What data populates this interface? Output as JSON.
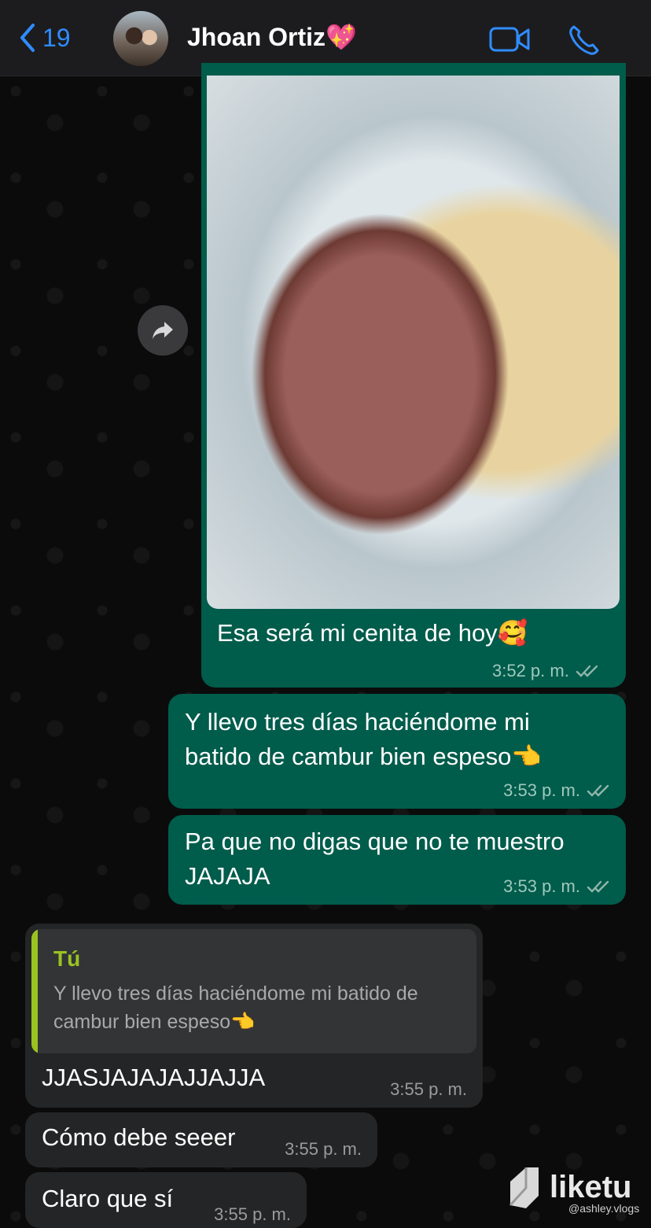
{
  "header": {
    "back_count": "19",
    "contact_name": "Jhoan Ortiz💖"
  },
  "messages": [
    {
      "type": "out",
      "text": "Esa será mi cenita de hoy🥰",
      "time": "3:52 p. m."
    },
    {
      "type": "out",
      "text": "Y llevo tres días haciéndome mi batido de cambur bien espeso👈",
      "time": "3:53 p. m."
    },
    {
      "type": "out",
      "text": "Pa que no digas que no te muestro JAJAJA",
      "time": "3:53 p. m."
    },
    {
      "type": "in",
      "reply_author": "Tú",
      "reply_text": "Y llevo tres días haciéndome mi batido de cambur bien espeso👈",
      "text": "JJASJAJAJAJJAJJA",
      "time": "3:55 p. m."
    },
    {
      "type": "in",
      "text": "Cómo debe seeer",
      "time": "3:55 p. m."
    },
    {
      "type": "in",
      "text": "Claro que sí",
      "time": "3:55 p. m."
    }
  ],
  "watermark": {
    "brand": "liketu",
    "handle": "@ashley.vlogs"
  },
  "colors": {
    "accent": "#2f8cff",
    "outgoing": "#005c4b",
    "incoming": "#242526",
    "reply_author": "#9ac322"
  }
}
